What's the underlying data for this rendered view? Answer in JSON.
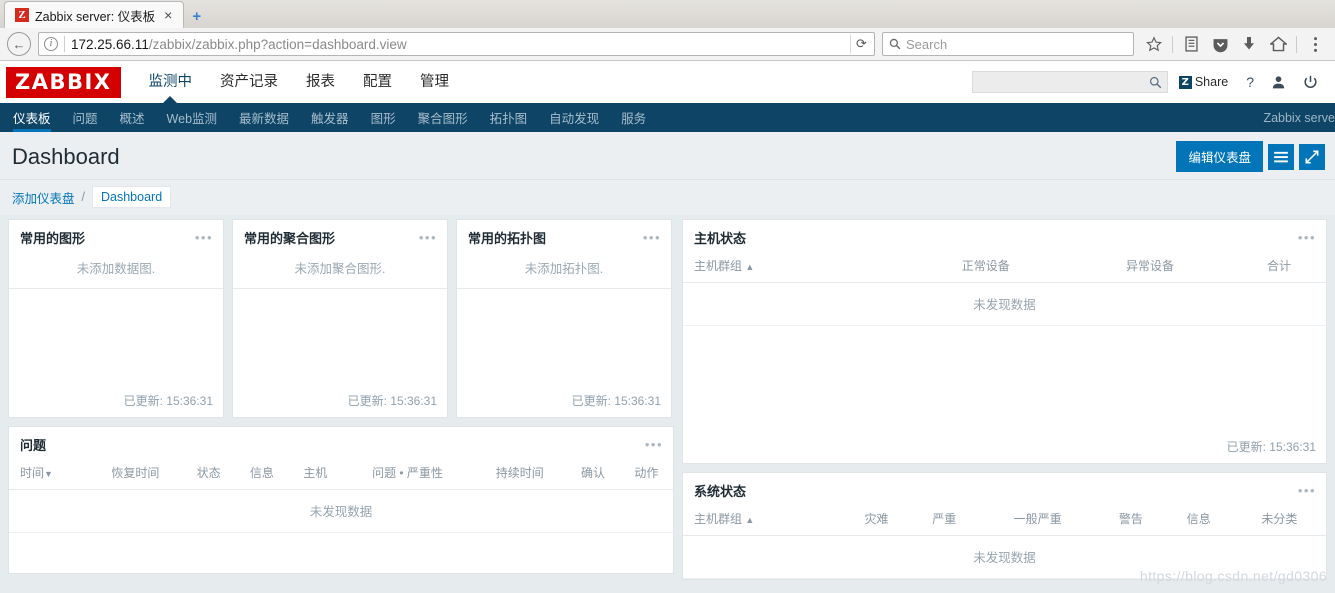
{
  "browser": {
    "tab": {
      "title": "Zabbix server: 仪表板",
      "favicon_letter": "Z",
      "close_label": "×"
    },
    "new_tab_label": "+",
    "back_label": "←",
    "info_label": "i",
    "url_host": "172.25.66.11",
    "url_path": "/zabbix/zabbix.php?action=dashboard.view",
    "reload_label": "⟳",
    "search_placeholder": "Search",
    "toolbar_icons": [
      "star-icon",
      "library-icon",
      "pocket-icon",
      "download-icon",
      "home-icon",
      "menu-icon"
    ]
  },
  "header": {
    "logo": "ZABBIX",
    "main_nav": [
      {
        "label": "监测中",
        "active": true
      },
      {
        "label": "资产记录",
        "active": false
      },
      {
        "label": "报表",
        "active": false
      },
      {
        "label": "配置",
        "active": false
      },
      {
        "label": "管理",
        "active": false
      }
    ],
    "search_value": "",
    "share_label": "Share",
    "share_badge": "Z",
    "help_label": "?",
    "user_icon": "user-icon",
    "power_icon": "power-icon"
  },
  "subnav": {
    "items": [
      {
        "label": "仪表板",
        "active": true
      },
      {
        "label": "问题",
        "active": false
      },
      {
        "label": "概述",
        "active": false
      },
      {
        "label": "Web监测",
        "active": false
      },
      {
        "label": "最新数据",
        "active": false
      },
      {
        "label": "触发器",
        "active": false
      },
      {
        "label": "图形",
        "active": false
      },
      {
        "label": "聚合图形",
        "active": false
      },
      {
        "label": "拓扑图",
        "active": false
      },
      {
        "label": "自动发现",
        "active": false
      },
      {
        "label": "服务",
        "active": false
      }
    ],
    "server_name": "Zabbix serve"
  },
  "page": {
    "title": "Dashboard",
    "edit_button": "编辑仪表盘",
    "menu_button": "☰",
    "fullscreen_button": "⤢",
    "breadcrumb": {
      "parent": "添加仪表盘",
      "separator": "/",
      "current": "Dashboard"
    }
  },
  "widgets": {
    "favourite_graphs": {
      "title": "常用的图形",
      "empty": "未添加数据图.",
      "updated": "已更新: 15:36:31",
      "menu": "•••"
    },
    "favourite_screens": {
      "title": "常用的聚合图形",
      "empty": "未添加聚合图形.",
      "updated": "已更新: 15:36:31",
      "menu": "•••"
    },
    "favourite_maps": {
      "title": "常用的拓扑图",
      "empty": "未添加拓扑图.",
      "updated": "已更新: 15:36:31",
      "menu": "•••"
    },
    "host_status": {
      "title": "主机状态",
      "menu": "•••",
      "columns": [
        {
          "label": "主机群组",
          "sort": "▲"
        },
        {
          "label": "正常设备",
          "sort": ""
        },
        {
          "label": "异常设备",
          "sort": ""
        },
        {
          "label": "合计",
          "sort": ""
        }
      ],
      "no_data": "未发现数据",
      "updated": "已更新: 15:36:31"
    },
    "problems": {
      "title": "问题",
      "menu": "•••",
      "columns": [
        {
          "label": "时间",
          "sort": "▼"
        },
        {
          "label": "恢复时间",
          "sort": ""
        },
        {
          "label": "状态",
          "sort": ""
        },
        {
          "label": "信息",
          "sort": ""
        },
        {
          "label": "主机",
          "sort": ""
        },
        {
          "label": "问题 • 严重性",
          "sort": ""
        },
        {
          "label": "持续时间",
          "sort": ""
        },
        {
          "label": "确认",
          "sort": ""
        },
        {
          "label": "动作",
          "sort": ""
        }
      ],
      "no_data": "未发现数据"
    },
    "system_status": {
      "title": "系统状态",
      "menu": "•••",
      "columns": [
        {
          "label": "主机群组",
          "sort": "▲"
        },
        {
          "label": "灾难",
          "sort": ""
        },
        {
          "label": "严重",
          "sort": ""
        },
        {
          "label": "一般严重",
          "sort": ""
        },
        {
          "label": "警告",
          "sort": ""
        },
        {
          "label": "信息",
          "sort": ""
        },
        {
          "label": "未分类",
          "sort": ""
        }
      ],
      "no_data": "未发现数据"
    }
  },
  "watermark": "https://blog.csdn.net/gd0306",
  "colors": {
    "brand_red": "#d40000",
    "header_navy": "#0e4566",
    "accent_blue": "#0275b8",
    "page_bg": "#e6ebee"
  }
}
